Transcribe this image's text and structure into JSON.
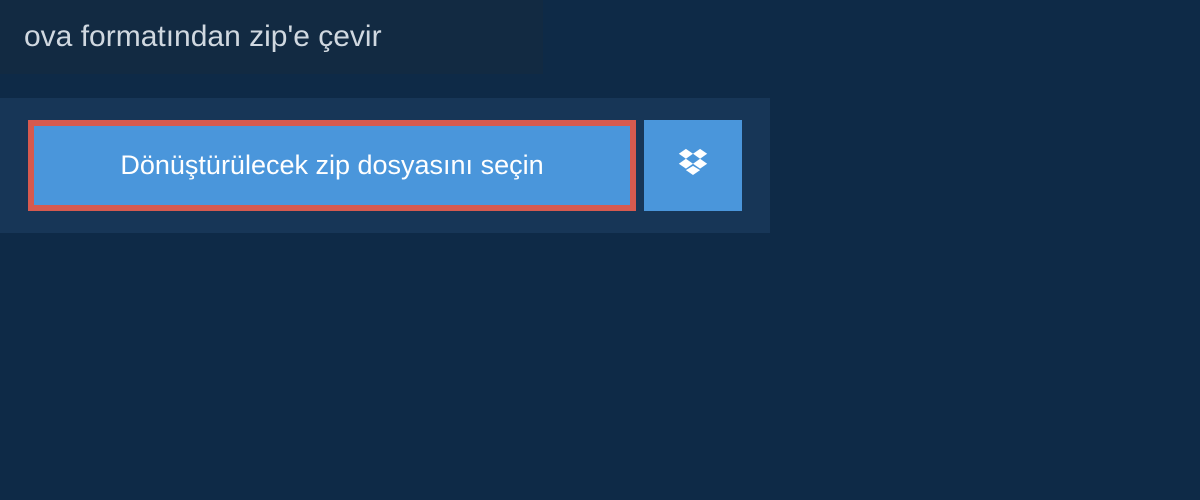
{
  "header": {
    "title": "ova formatından zip'e çevir"
  },
  "actions": {
    "select_file_label": "Dönüştürülecek zip dosyasını seçin"
  }
}
